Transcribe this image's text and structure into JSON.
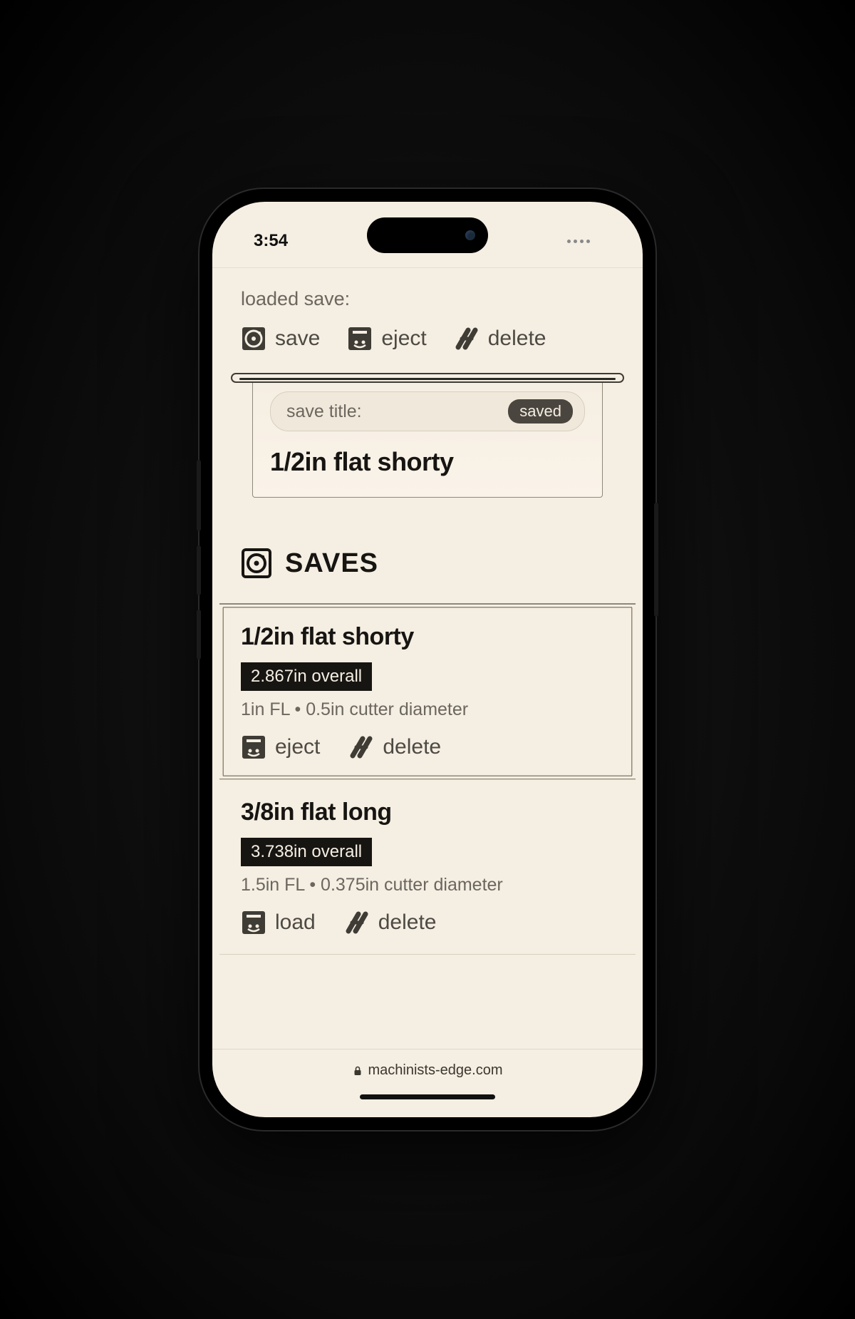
{
  "statusbar": {
    "time": "3:54"
  },
  "loaded": {
    "label": "loaded save:",
    "actions": {
      "save": "save",
      "eject": "eject",
      "delete": "delete"
    },
    "title_field_label": "save title:",
    "saved_badge": "saved",
    "title_value": "1/2in flat shorty"
  },
  "saves_header": "SAVES",
  "saves": [
    {
      "title": "1/2in flat shorty",
      "overall": "2.867in overall",
      "detail": "1in FL • 0.5in cutter diameter",
      "action1": "eject",
      "action2": "delete",
      "active": true
    },
    {
      "title": "3/8in flat long",
      "overall": "3.738in overall",
      "detail": "1.5in FL • 0.375in cutter diameter",
      "action1": "load",
      "action2": "delete",
      "active": false
    }
  ],
  "browser": {
    "url": "machinists-edge.com"
  }
}
